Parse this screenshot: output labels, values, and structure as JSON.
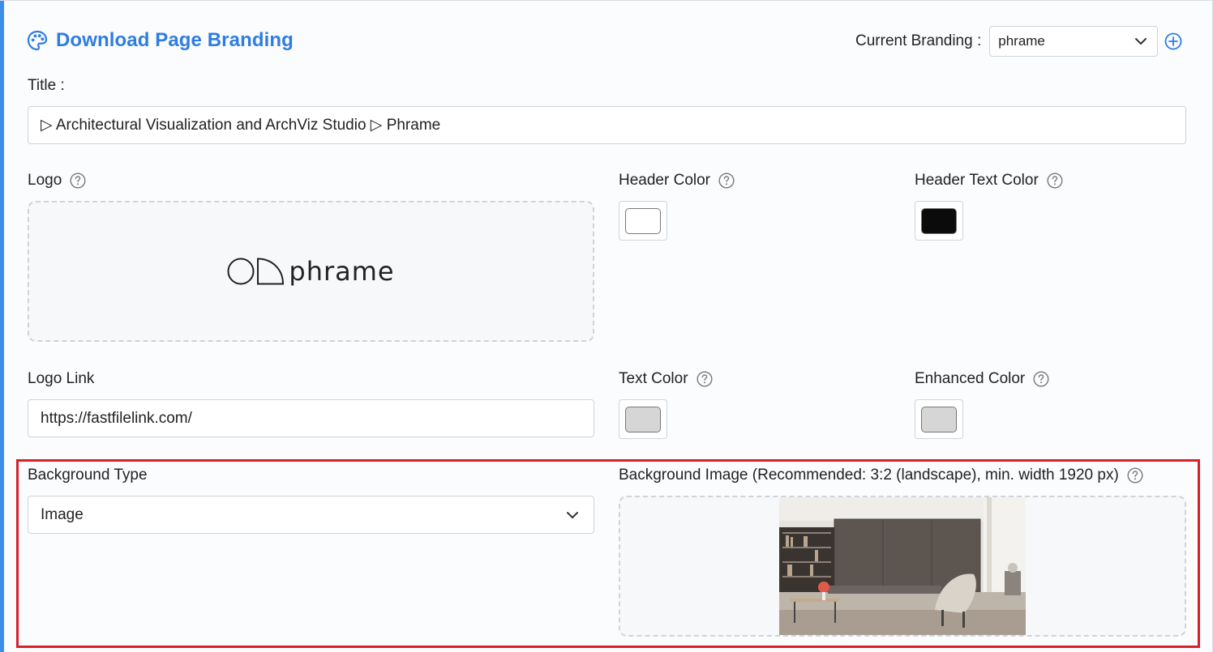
{
  "header": {
    "title": "Download Page Branding",
    "current_branding_label": "Current Branding :",
    "current_branding_value": "phrame"
  },
  "title_field": {
    "label": "Title :",
    "value": "▷ Architectural Visualization and ArchViz Studio ▷ Phrame"
  },
  "logo": {
    "label": "Logo",
    "logo_text": "phrame"
  },
  "header_color": {
    "label": "Header Color",
    "value": "#ffffff"
  },
  "header_text_color": {
    "label": "Header Text Color",
    "value": "#0b0b0b"
  },
  "logo_link": {
    "label": "Logo Link",
    "value": "https://fastfilelink.com/"
  },
  "text_color": {
    "label": "Text Color",
    "value": "#d6d6d6"
  },
  "enhanced_color": {
    "label": "Enhanced Color",
    "value": "#d6d6d6"
  },
  "background_type": {
    "label": "Background Type",
    "value": "Image"
  },
  "background_image": {
    "label": "Background Image (Recommended: 3:2 (landscape), min. width 1920 px)"
  },
  "colors": {
    "accent": "#2e7de1",
    "highlight": "#d8202a",
    "border": "#cfd4da"
  }
}
